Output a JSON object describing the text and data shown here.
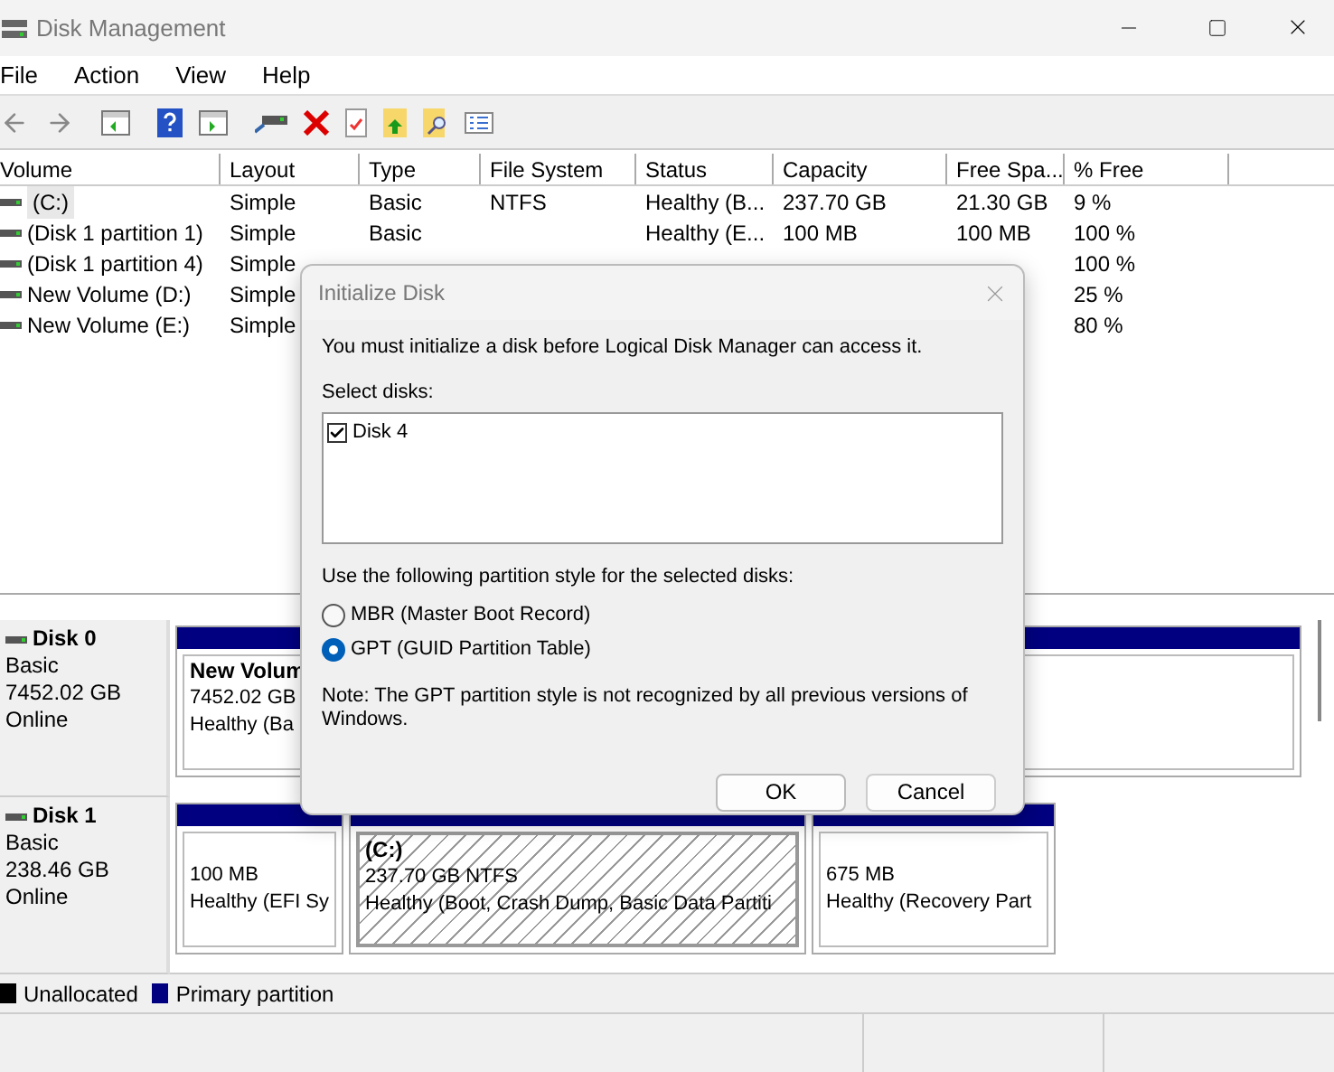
{
  "window": {
    "title": "Disk Management"
  },
  "menu": [
    {
      "label": "File"
    },
    {
      "label": "Action"
    },
    {
      "label": "View"
    },
    {
      "label": "Help"
    }
  ],
  "table": {
    "columns": [
      "Volume",
      "Layout",
      "Type",
      "File System",
      "Status",
      "Capacity",
      "Free Spa...",
      "% Free"
    ],
    "rows": [
      {
        "selected": true,
        "volume": "(C:)",
        "layout": "Simple",
        "type": "Basic",
        "file_system": "NTFS",
        "status": "Healthy (B...",
        "capacity": "237.70 GB",
        "free_space": "21.30 GB",
        "percent_free": "9 %"
      },
      {
        "selected": false,
        "volume": "(Disk 1 partition 1)",
        "layout": "Simple",
        "type": "Basic",
        "status": "Healthy (E...",
        "capacity": "100 MB",
        "free_space": "100 MB",
        "percent_free": "100 %"
      },
      {
        "selected": false,
        "volume": "(Disk 1 partition 4)",
        "layout": "Simple",
        "percent_free": "100 %"
      },
      {
        "selected": false,
        "volume": "New Volume (D:)",
        "layout": "Simple",
        "percent_free": "25 %"
      },
      {
        "selected": false,
        "volume": "New Volume (E:)",
        "layout": "Simple",
        "percent_free": "80 %"
      }
    ]
  },
  "disks": [
    {
      "name": "Disk 0",
      "type": "Basic",
      "size": "7452.02 GB",
      "status": "Online",
      "partitions": [
        {
          "name": "New Volum",
          "size": "7452.02 GB",
          "status": "Healthy (Ba",
          "hatched": false
        }
      ]
    },
    {
      "name": "Disk 1",
      "type": "Basic",
      "size": "238.46 GB",
      "status": "Online",
      "partitions": [
        {
          "size": "100 MB",
          "status": "Healthy (EFI Sy",
          "hatched": false
        },
        {
          "name": "(C:)",
          "size": "237.70 GB NTFS",
          "status": "Healthy (Boot, Crash Dump, Basic Data Partiti",
          "hatched": true
        },
        {
          "size": "675 MB",
          "status": "Healthy (Recovery Part",
          "hatched": false
        }
      ]
    }
  ],
  "legend": [
    {
      "label": "Unallocated",
      "color": "#000000"
    },
    {
      "label": "Primary partition",
      "color": "#000080"
    }
  ],
  "dialog": {
    "title": "Initialize Disk",
    "message": "You must initialize a disk before Logical Disk Manager can access it.",
    "disks_label": "Select disks:",
    "disks": [
      {
        "label": "Disk 4",
        "checked": true
      }
    ],
    "style_label": "Use the following partition style for the selected disks:",
    "options": [
      {
        "label": "MBR (Master Boot Record)",
        "selected": false
      },
      {
        "label": "GPT (GUID Partition Table)",
        "selected": true
      }
    ],
    "note": "Note: The GPT partition style is not recognized by all previous versions of Windows.",
    "buttons": [
      {
        "label": "OK",
        "kind": "default"
      },
      {
        "label": "Cancel",
        "kind": "normal"
      }
    ]
  }
}
